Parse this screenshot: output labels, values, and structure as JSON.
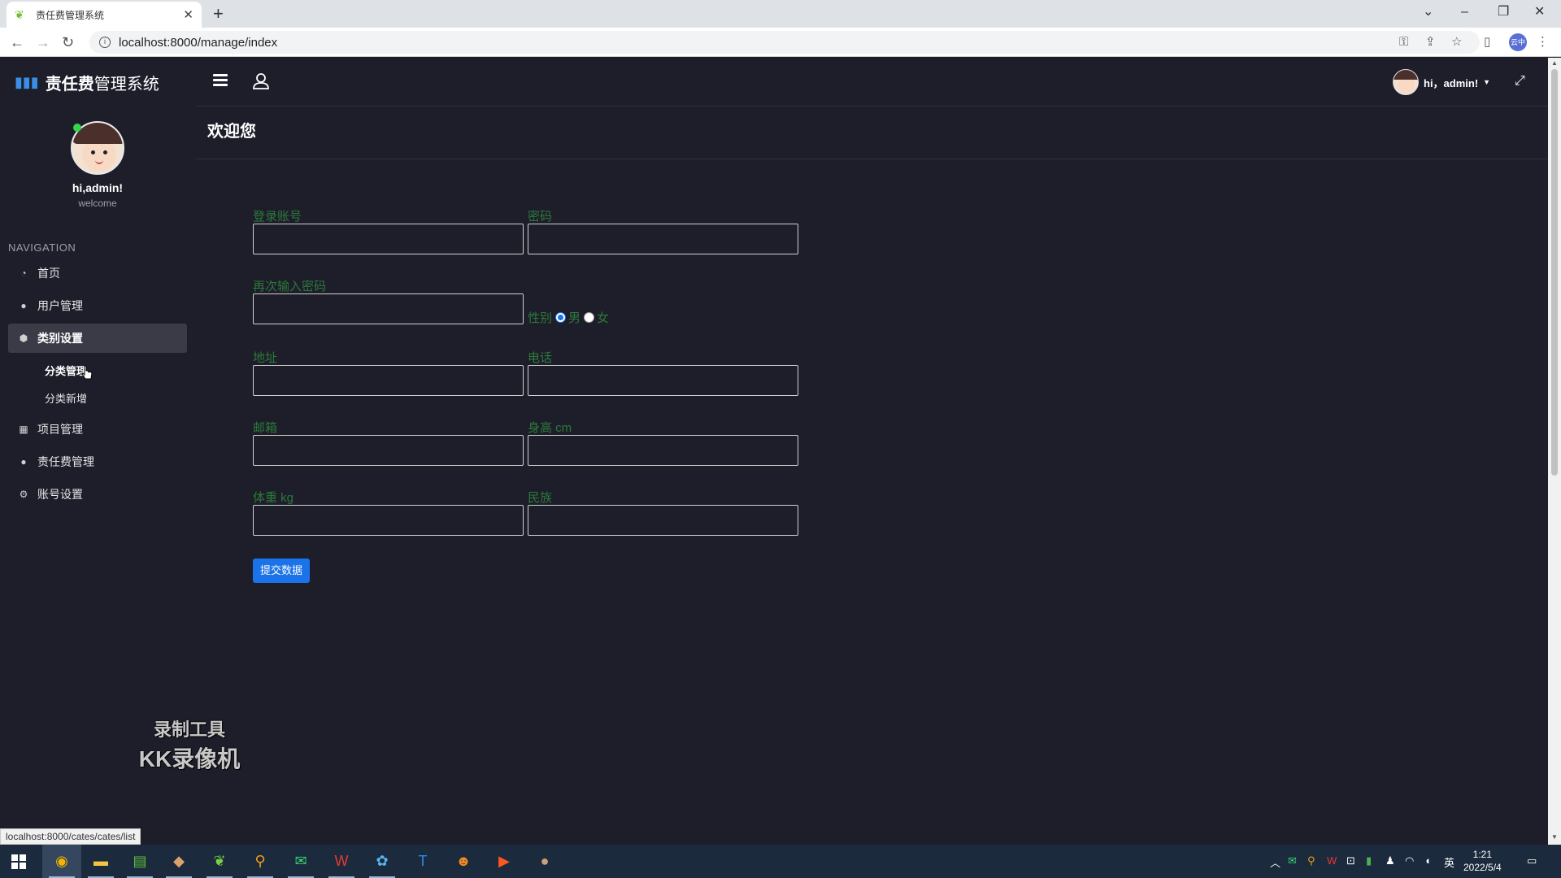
{
  "browser": {
    "tab_title": "责任费管理系统",
    "tab_close": "✕",
    "new_tab": "+",
    "url": "localhost:8000/manage/index",
    "status_url": "localhost:8000/cates/cates/list",
    "profile_label": "云中"
  },
  "sidebar": {
    "brand_bold": "责任费",
    "brand_rest": "管理系统",
    "user_name": "hi,admin!",
    "user_sub": "welcome",
    "nav_heading": "NAVIGATION",
    "items": [
      {
        "label": "首页",
        "icon": "dashboard-icon"
      },
      {
        "label": "用户管理",
        "icon": "user-icon"
      },
      {
        "label": "类别设置",
        "icon": "cube-icon"
      },
      {
        "label": "项目管理",
        "icon": "grid-icon"
      },
      {
        "label": "责任费管理",
        "icon": "circle-icon"
      },
      {
        "label": "账号设置",
        "icon": "gear-icon"
      }
    ],
    "sub_items": [
      "分类管理",
      "分类新增"
    ]
  },
  "header": {
    "user_greeting": "hi，admin!"
  },
  "main": {
    "title": "欢迎您",
    "labels": {
      "account": "登录账号",
      "password": "密码",
      "password_again": "再次输入密码",
      "gender": "性别",
      "male": "男",
      "female": "女",
      "address": "地址",
      "phone": "电话",
      "email": "邮箱",
      "height": "身高 cm",
      "weight": "体重 kg",
      "ethnicity": "民族"
    },
    "gender_selected": "男",
    "submit": "提交数据"
  },
  "watermark": {
    "line1": "录制工具",
    "line2": "KK录像机"
  },
  "taskbar": {
    "time": "1:21",
    "date": "2022/5/4",
    "ime": "英"
  }
}
